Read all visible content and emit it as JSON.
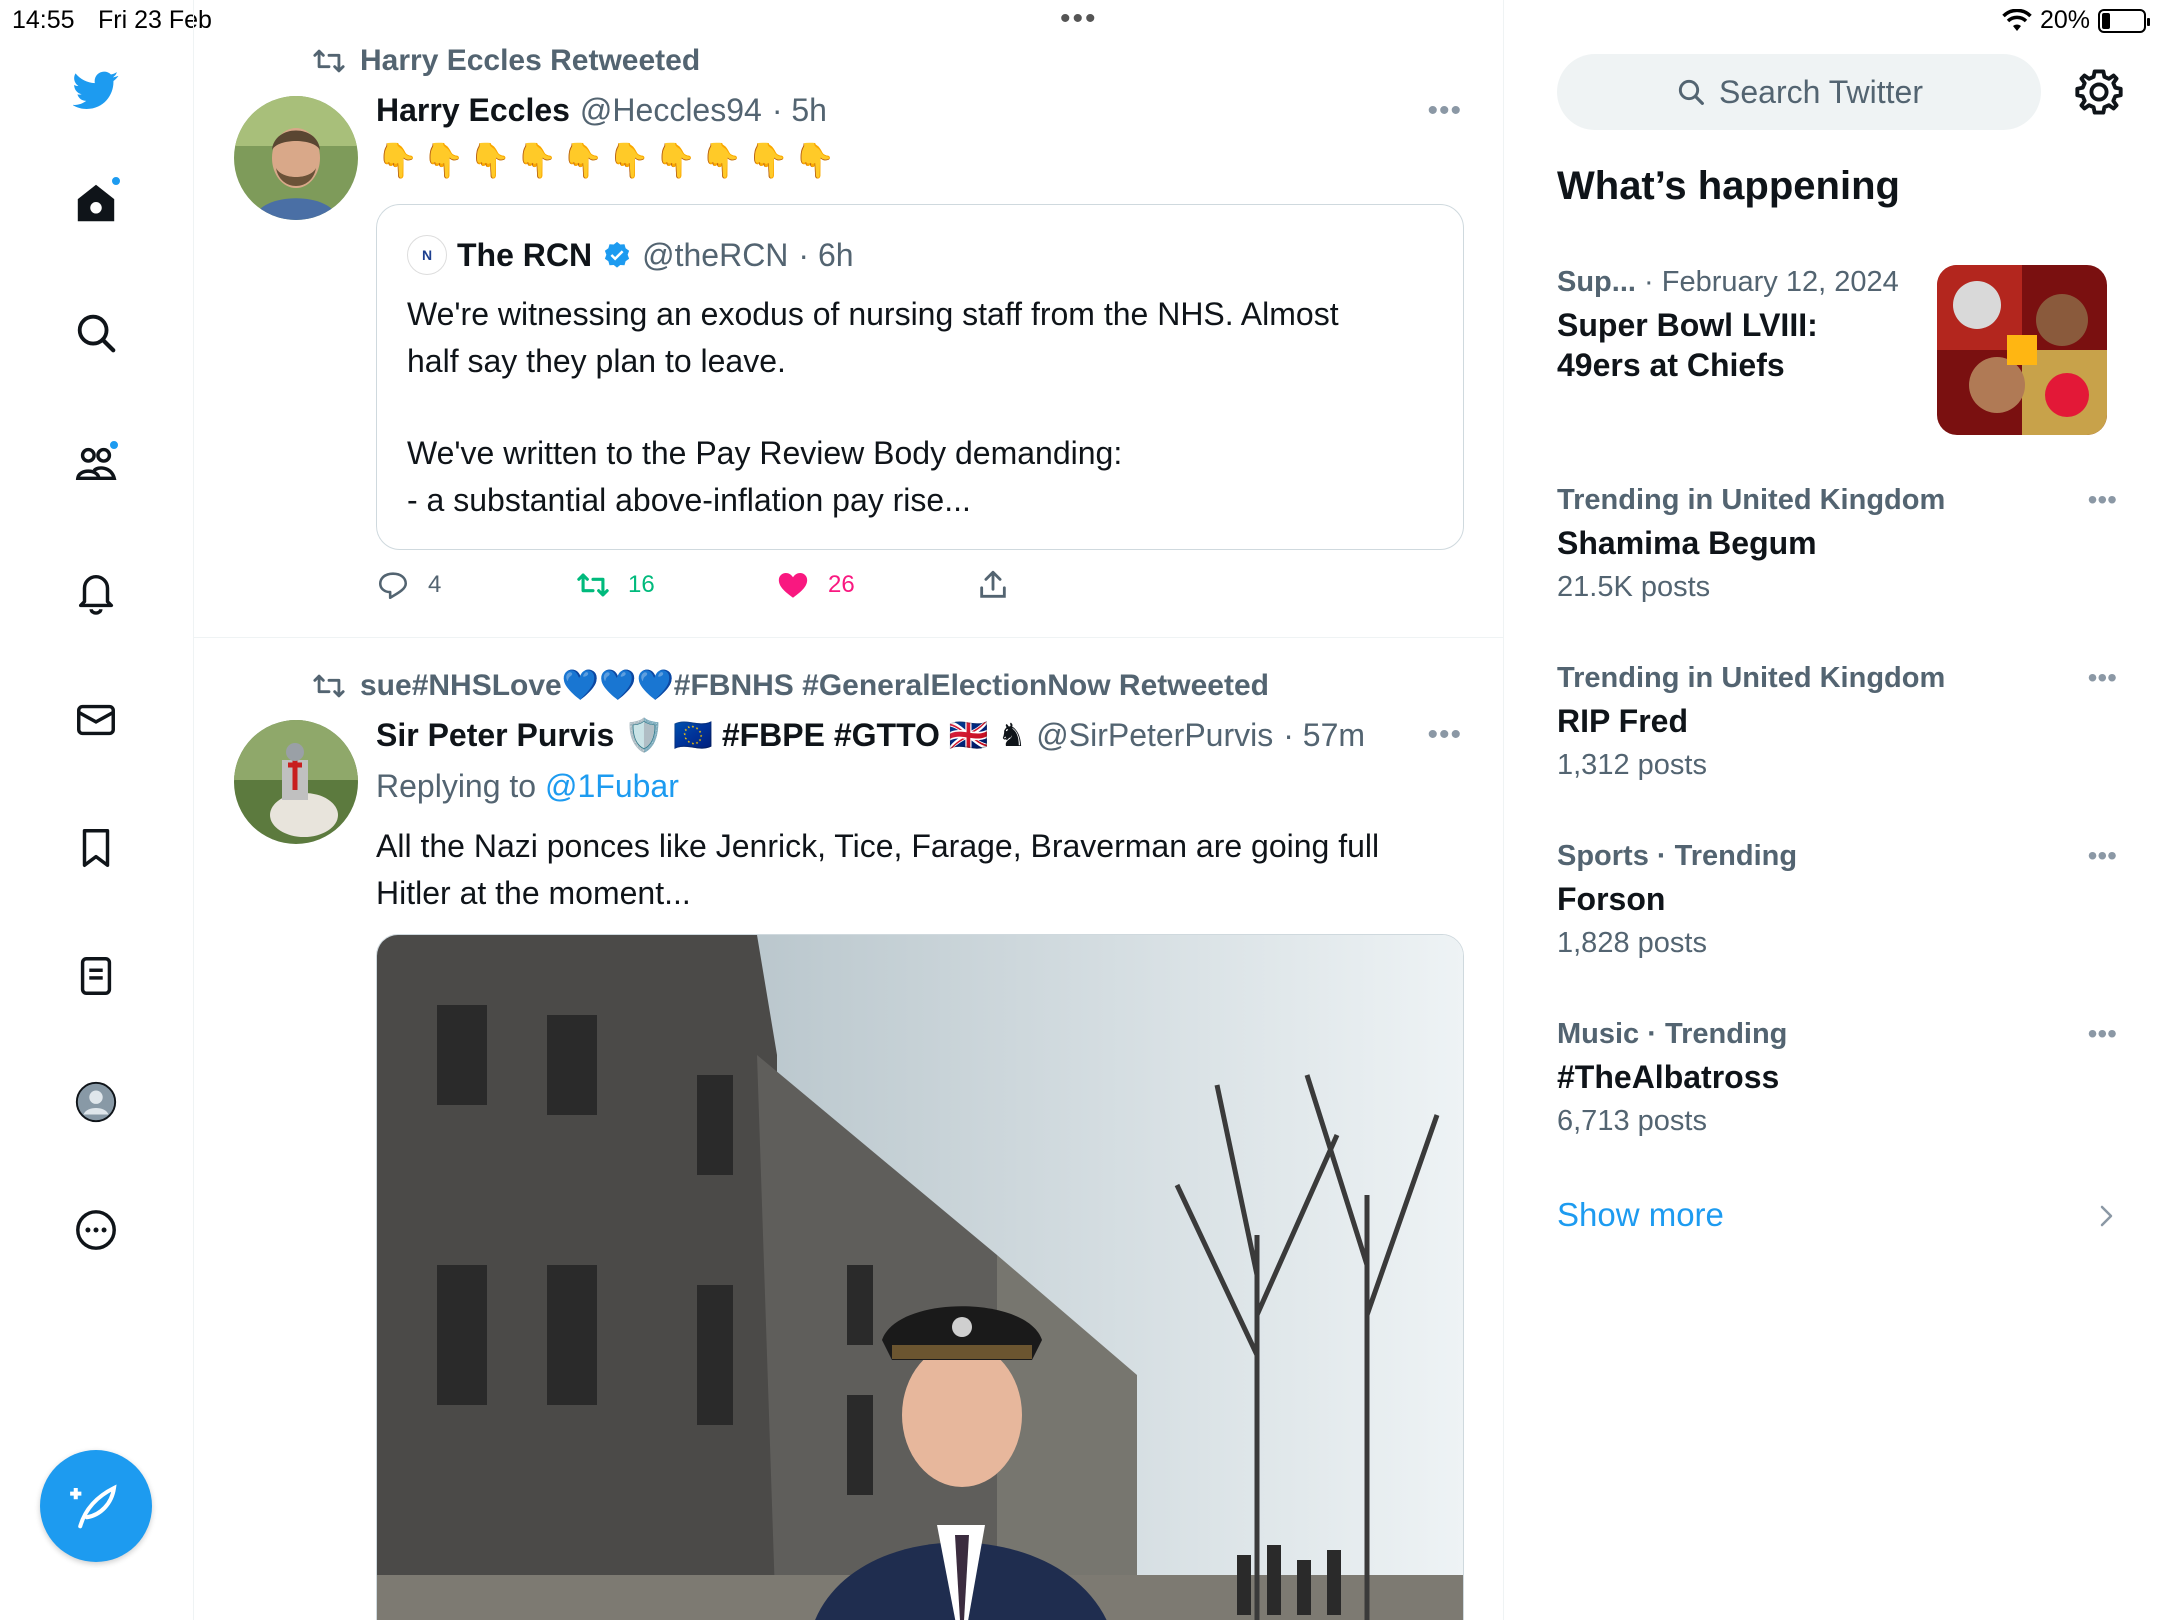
{
  "status_bar": {
    "time": "14:55",
    "date": "Fri 23 Feb",
    "multitask": "•••",
    "battery": "20%",
    "battery_level": 0.2
  },
  "nav": {
    "items": [
      "twitter-logo",
      "home",
      "explore",
      "communities",
      "notifications",
      "messages",
      "bookmarks",
      "lists",
      "profile",
      "more"
    ]
  },
  "colors": {
    "accent": "#1d9bf0",
    "like": "#f91880",
    "retweet": "#00ba7c",
    "secondary": "#536471"
  },
  "timeline": {
    "tweet1": {
      "retweeted_by": "Harry Eccles Retweeted",
      "name": "Harry Eccles",
      "handle": "@Heccles94",
      "time": "· 5h",
      "body": "👇👇👇👇👇👇👇👇👇👇",
      "quote": {
        "name": "The RCN",
        "handle": "@theRCN",
        "time": "· 6h",
        "line1": "We're witnessing an exodus of nursing staff from the NHS. Almost",
        "line2": "half say they plan to leave.",
        "line3": "We've written to the Pay Review Body demanding:",
        "line4": "- a substantial above-inflation pay rise..."
      },
      "replies": "4",
      "retweets": "16",
      "likes": "26"
    },
    "tweet2": {
      "retweeted_by": "sue#NHSLove💙💙💙#FBNHS #GeneralElectionNow Retweeted",
      "name": "Sir Peter Purvis",
      "name_suffix": "🛡️ 🇪🇺 #FBPE #GTTO 🇬🇧 ♞",
      "handle": "@SirPeterPurvis",
      "time": "· 57m",
      "replying_label": "Replying to",
      "replying_handle": "@1Fubar",
      "line1": "All the Nazi ponces like Jenrick, Tice, Farage, Braverman are going full",
      "line2": "Hitler at the moment..."
    }
  },
  "right": {
    "search_placeholder": "Search Twitter",
    "heading": "What’s happening",
    "trends": [
      {
        "context": "Sup...",
        "context_extra": "· February 12, 2024",
        "topic_line1": "Super Bowl LVIII:",
        "topic_line2": "49ers at Chiefs"
      },
      {
        "context": "Trending in United Kingdom",
        "topic": "Shamima Begum",
        "posts": "21.5K posts"
      },
      {
        "context": "Trending in United Kingdom",
        "topic": "RIP Fred",
        "posts": "1,312 posts"
      },
      {
        "context": "Sports · Trending",
        "topic": "Forson",
        "posts": "1,828 posts"
      },
      {
        "context": "Music · Trending",
        "topic": "#TheAlbatross",
        "posts": "6,713 posts"
      }
    ],
    "show_more": "Show more"
  }
}
